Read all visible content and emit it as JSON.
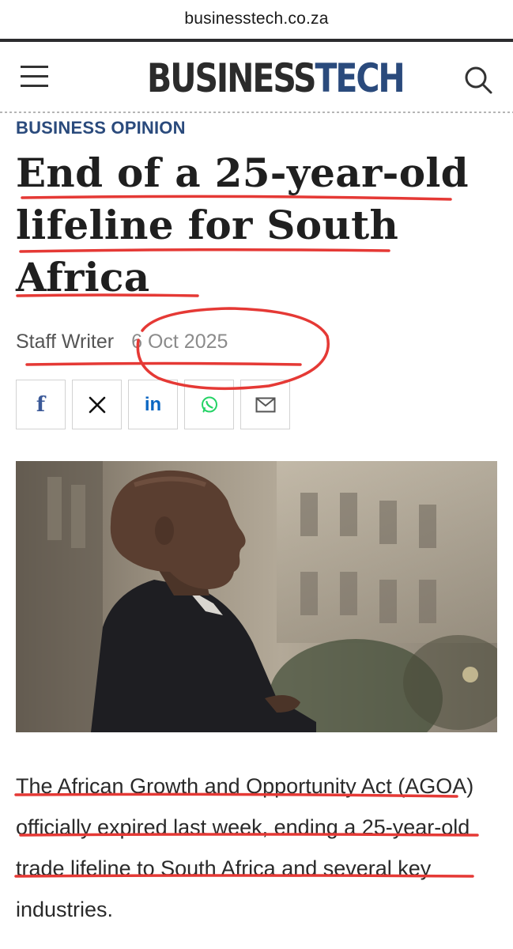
{
  "browser": {
    "url": "businesstech.co.za"
  },
  "header": {
    "menu_icon": "hamburger-menu-icon",
    "logo_part1": "BUSINESS",
    "logo_part2": "TECH",
    "search_icon": "search-icon"
  },
  "article": {
    "category": "BUSINESS OPINION",
    "title": "End of a 25-year-old lifeline for South Africa",
    "author": "Staff Writer",
    "date": "6 Oct 2025",
    "share": [
      {
        "label": "f",
        "icon": "facebook-icon",
        "color": "#3b5998"
      },
      {
        "label": "𝕏",
        "icon": "x-icon",
        "color": "#111111"
      },
      {
        "label": "in",
        "icon": "linkedin-icon",
        "color": "#0a66c2"
      },
      {
        "label": "whatsapp",
        "icon": "whatsapp-icon",
        "color": "#25d366"
      },
      {
        "label": "email",
        "icon": "email-icon",
        "color": "#555555"
      }
    ],
    "hero_image": "photo-man-in-suit-profile",
    "lede": "The African Growth and Opportunity Act (AGOA) officially expired last week, ending a 25-year-old trade lifeline to South Africa and several key industries."
  },
  "colors": {
    "brand": "#2a4a7c",
    "annotation": "#e53935"
  }
}
